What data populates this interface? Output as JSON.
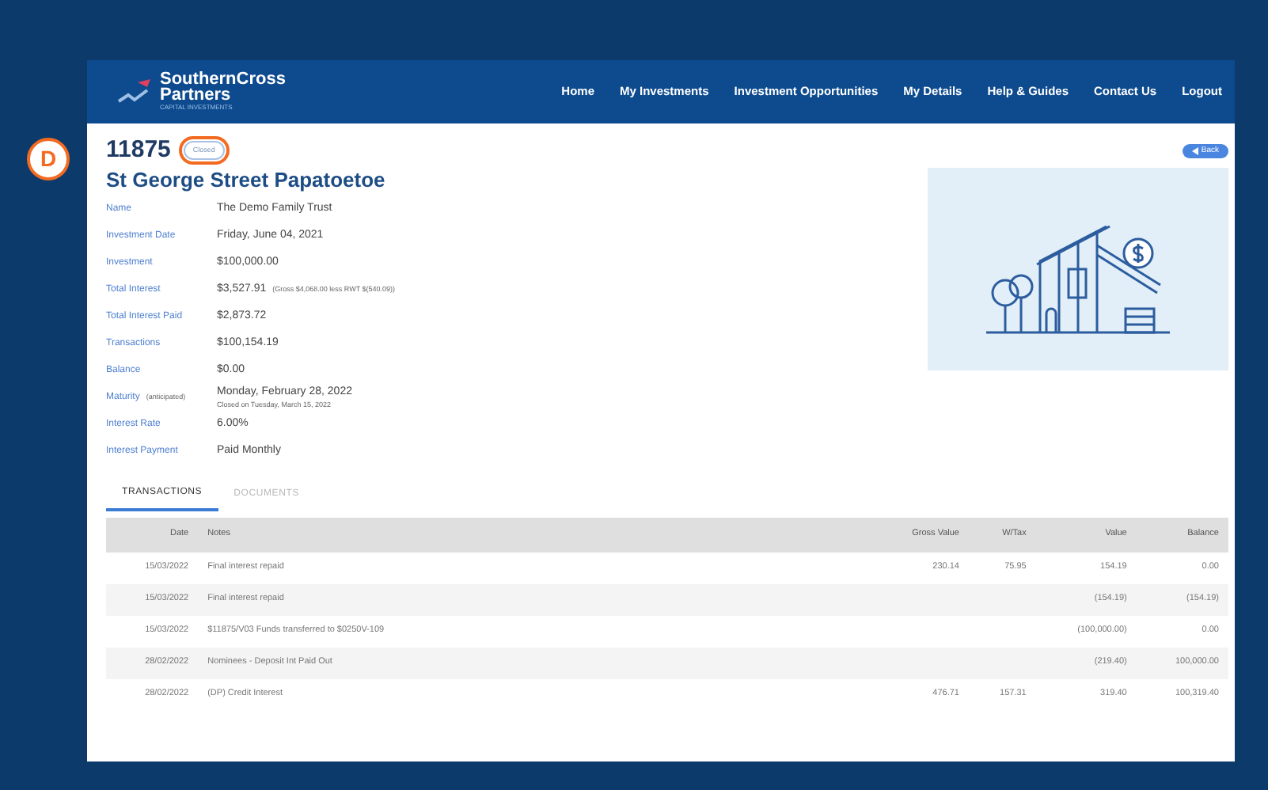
{
  "annotation": {
    "label": "D"
  },
  "navbar": {
    "logo": {
      "line1": "SouthernCross",
      "line2": "Partners",
      "tagline": "CAPITAL INVESTMENTS"
    },
    "items": [
      {
        "label": "Home"
      },
      {
        "label": "My Investments"
      },
      {
        "label": "Investment Opportunities"
      },
      {
        "label": "My Details"
      },
      {
        "label": "Help & Guides"
      },
      {
        "label": "Contact Us"
      },
      {
        "label": "Logout"
      }
    ]
  },
  "investment": {
    "number": "11875",
    "status": "Closed",
    "back_button": "Back",
    "title": "St George Street Papatoetoe",
    "details": [
      {
        "label": "Name",
        "value": "The Demo Family Trust"
      },
      {
        "label": "Investment Date",
        "value": "Friday, June 04, 2021"
      },
      {
        "label": "Investment",
        "value": "$100,000.00"
      },
      {
        "label": "Total Interest",
        "value": "$3,527.91",
        "note": "(Gross $4,068.00 less RWT $(540.09))"
      },
      {
        "label": "Total Interest Paid",
        "value": "$2,873.72"
      },
      {
        "label": "Transactions",
        "value": "$100,154.19"
      },
      {
        "label": "Balance",
        "value": "$0.00"
      },
      {
        "label": "Maturity",
        "label_note": "(anticipated)",
        "value": "Monday, February 28, 2022",
        "sub": "Closed on Tuesday, March 15, 2022"
      },
      {
        "label": "Interest Rate",
        "value": "6.00%"
      },
      {
        "label": "Interest Payment",
        "value": "Paid Monthly"
      }
    ]
  },
  "tabs": [
    {
      "label": "TRANSACTIONS",
      "selected": true
    },
    {
      "label": "DOCUMENTS",
      "selected": false
    }
  ],
  "table": {
    "columns": [
      "Date",
      "Notes",
      "Gross Value",
      "W/Tax",
      "Value",
      "Balance"
    ],
    "rows": [
      [
        "15/03/2022",
        "Final interest repaid",
        "230.14",
        "75.95",
        "154.19",
        "0.00"
      ],
      [
        "15/03/2022",
        "Final interest repaid",
        "",
        "",
        "(154.19)",
        "(154.19)"
      ],
      [
        "15/03/2022",
        "$11875/V03 Funds transferred to $0250V-109",
        "",
        "",
        "(100,000.00)",
        "0.00"
      ],
      [
        "28/02/2022",
        "Nominees - Deposit Int Paid Out",
        "",
        "",
        "(219.40)",
        "100,000.00"
      ],
      [
        "28/02/2022",
        "(DP) Credit Interest",
        "476.71",
        "157.31",
        "319.40",
        "100,319.40"
      ]
    ]
  }
}
